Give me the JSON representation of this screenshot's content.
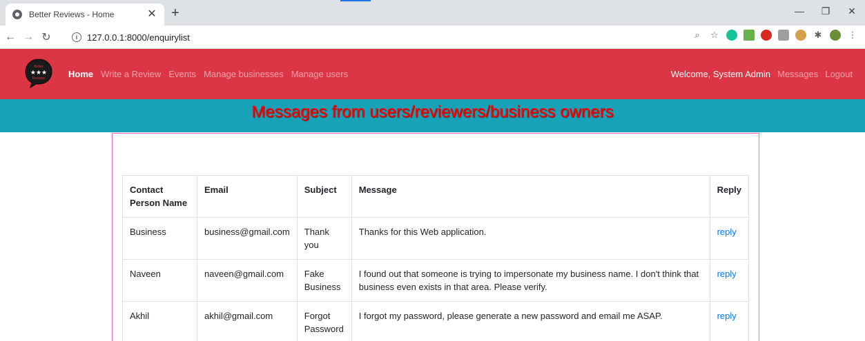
{
  "browser": {
    "tab_title": "Better Reviews - Home",
    "url": "127.0.0.1:8000/enquirylist"
  },
  "navbar": {
    "logo_text": [
      "Better",
      "Reviews"
    ],
    "links": [
      "Home",
      "Write a Review",
      "Events",
      "Manage businesses",
      "Manage users"
    ],
    "welcome": "Welcome, System Admin",
    "messages": "Messages",
    "logout": "Logout"
  },
  "banner": {
    "title": "Messages from users/reviewers/business owners"
  },
  "table": {
    "headers": [
      "Contact Person Name",
      "Email",
      "Subject",
      "Message",
      "Reply"
    ],
    "rows": [
      {
        "name": "Business",
        "email": "business@gmail.com",
        "subject": "Thank you",
        "message": "Thanks for this Web application.",
        "reply": "reply"
      },
      {
        "name": "Naveen",
        "email": "naveen@gmail.com",
        "subject": "Fake Business",
        "message": "I found out that someone is trying to impersonate my business name. I don't think that business even exists in that area. Please verify.",
        "reply": "reply"
      },
      {
        "name": "Akhil",
        "email": "akhil@gmail.com",
        "subject": "Forgot Password",
        "message": "I forgot my password, please generate a new password and email me ASAP.",
        "reply": "reply"
      }
    ]
  },
  "colors": {
    "navbar": "#dc3545",
    "banner": "#17a2b8",
    "banner_text": "#ff0000",
    "link": "#007bff",
    "container_border": "#ff66cc"
  }
}
